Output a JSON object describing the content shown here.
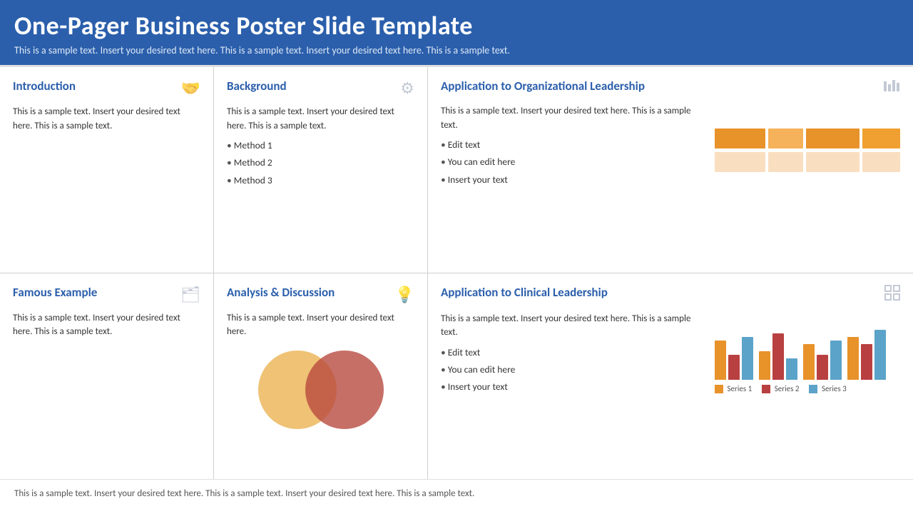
{
  "header": {
    "title": "One-Pager Business Poster Slide Template",
    "subtitle": "This is a sample text. Insert your desired text here. This is a sample text. Insert your desired text here. This is a sample text."
  },
  "footer": {
    "text": "This is a sample text. Insert your desired text here. This is a sample text. Insert your desired text here. This is a sample text."
  },
  "cells": {
    "introduction": {
      "title": "Introduction",
      "body": "This is a sample text. Insert your desired text here. This is a sample text."
    },
    "background": {
      "title": "Background",
      "body": "This is a sample text. Insert your desired text here. This is a sample text.",
      "list": [
        "Method 1",
        "Method 2",
        "Method 3"
      ]
    },
    "application_org": {
      "title": "Application to Organizational Leadership",
      "body": "This is a sample text. Insert your desired text here. This is a sample text.",
      "list": [
        "Edit text",
        "You can edit here",
        "Insert your text"
      ]
    },
    "famous_example": {
      "title": "Famous Example",
      "body": "This is a sample text. Insert your desired text here. This is a sample text."
    },
    "analysis": {
      "title": "Analysis & Discussion",
      "body": "This is a sample text. Insert your desired text here."
    },
    "application_clinical": {
      "title": "Application to Clinical Leadership",
      "body": "This is a sample text. Insert your desired text here. This is a sample text.",
      "list": [
        "Edit text",
        "You can edit here",
        "Insert your text"
      ]
    }
  },
  "chart_org": {
    "row1": [
      {
        "color": "#e8922a",
        "width": 95
      },
      {
        "color": "#f5b25a",
        "width": 65
      },
      {
        "color": "#e8922a",
        "width": 100
      },
      {
        "color": "#f0a030",
        "width": 70
      }
    ],
    "row2": [
      {
        "color": "#f9dfc0",
        "width": 95
      },
      {
        "color": "#f9dfc0",
        "width": 65
      },
      {
        "color": "#f9dfc0",
        "width": 100
      },
      {
        "color": "#f9dfc0",
        "width": 70
      }
    ]
  },
  "chart_clinical": {
    "groups": [
      {
        "orange": 55,
        "red": 35,
        "blue": 60
      },
      {
        "orange": 40,
        "red": 65,
        "blue": 30
      },
      {
        "orange": 50,
        "red": 35,
        "blue": 55
      },
      {
        "orange": 60,
        "red": 50,
        "blue": 70
      }
    ],
    "legend": [
      "Series 1",
      "Series 2",
      "Series 3"
    ]
  },
  "icons": {
    "handshake": "🤝",
    "gear": "⚙",
    "chart": "▦",
    "folder": "🗂",
    "bulb": "💡",
    "expand": "⛶"
  }
}
